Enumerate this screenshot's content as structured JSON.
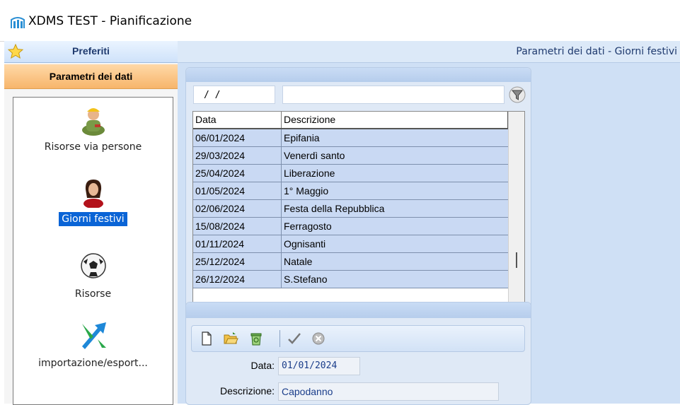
{
  "window": {
    "title": "XDMS TEST - Pianificazione",
    "icon": "app-logo-icon"
  },
  "sidebar": {
    "favorites_label": "Preferiti",
    "section_label": "Parametri dei dati",
    "items": [
      {
        "label": "Risorse via persone",
        "icon": "worker-person-icon",
        "selected": false
      },
      {
        "label": "Giorni festivi",
        "icon": "woman-avatar-icon",
        "selected": true
      },
      {
        "label": "Risorse",
        "icon": "soccer-ball-icon",
        "selected": false
      },
      {
        "label": "importazione/esport...",
        "icon": "import-export-icon",
        "selected": false
      }
    ]
  },
  "main": {
    "title": "Parametri dei dati - Giorni festivi",
    "filter": {
      "date_value": "/   /",
      "description_value": ""
    },
    "table": {
      "columns": [
        "Data",
        "Descrizione"
      ],
      "rows": [
        [
          "06/01/2024",
          "Epifania"
        ],
        [
          "29/03/2024",
          "Venerdì santo"
        ],
        [
          "25/04/2024",
          "Liberazione"
        ],
        [
          "01/05/2024",
          "1° Maggio"
        ],
        [
          "02/06/2024",
          "Festa della Repubblica"
        ],
        [
          "15/08/2024",
          "Ferragosto"
        ],
        [
          "01/11/2024",
          "Ognisanti"
        ],
        [
          "25/12/2024",
          "Natale"
        ],
        [
          "26/12/2024",
          "S.Stefano"
        ]
      ]
    },
    "detail": {
      "toolbar": [
        "new-document-icon",
        "open-folder-icon",
        "recycle-bin-icon",
        "checkmark-icon",
        "cancel-icon"
      ],
      "data_label": "Data:",
      "data_value": "01/01/2024",
      "description_label": "Descrizione:",
      "description_value": "Capodanno"
    }
  }
}
